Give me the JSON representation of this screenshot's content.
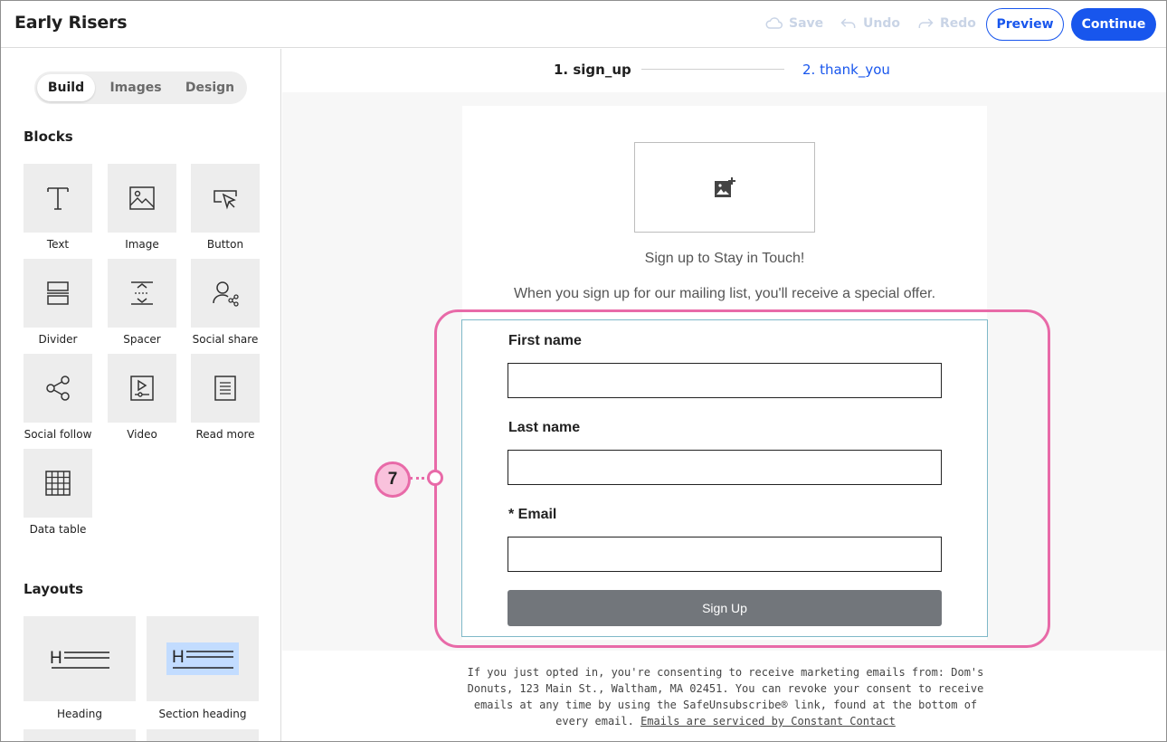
{
  "header": {
    "title": "Early Risers",
    "save_label": "Save",
    "undo_label": "Undo",
    "redo_label": "Redo",
    "preview_label": "Preview",
    "continue_label": "Continue"
  },
  "sidebar": {
    "tabs": [
      {
        "label": "Build",
        "active": true
      },
      {
        "label": "Images",
        "active": false
      },
      {
        "label": "Design",
        "active": false
      }
    ],
    "blocks_title": "Blocks",
    "blocks": [
      {
        "label": "Text",
        "icon": "text-icon"
      },
      {
        "label": "Image",
        "icon": "image-icon"
      },
      {
        "label": "Button",
        "icon": "button-icon"
      },
      {
        "label": "Divider",
        "icon": "divider-icon"
      },
      {
        "label": "Spacer",
        "icon": "spacer-icon"
      },
      {
        "label": "Social share",
        "icon": "social-share-icon"
      },
      {
        "label": "Social follow",
        "icon": "social-follow-icon"
      },
      {
        "label": "Video",
        "icon": "video-icon"
      },
      {
        "label": "Read more",
        "icon": "read-more-icon"
      },
      {
        "label": "Data table",
        "icon": "data-table-icon"
      }
    ],
    "layouts_title": "Layouts",
    "layouts": [
      {
        "label": "Heading",
        "icon": "heading-icon"
      },
      {
        "label": "Section heading",
        "icon": "section-heading-icon"
      }
    ]
  },
  "steps": [
    {
      "label": "1.  sign_up",
      "active": true
    },
    {
      "label": "2.  thank_you",
      "active": false
    }
  ],
  "form": {
    "heading": "Sign up to Stay in Touch!",
    "text": "When you sign up for our mailing list, you'll receive a special offer.",
    "fields": [
      {
        "label": "First name",
        "value": ""
      },
      {
        "label": "Last name",
        "value": ""
      },
      {
        "label": "* Email",
        "value": ""
      }
    ],
    "submit_label": "Sign Up"
  },
  "footer": {
    "text": "If you just opted in, you're consenting to receive marketing emails from: Dom's Donuts, 123 Main St., Waltham, MA 02451. You can revoke your consent to receive emails at any time by using the SafeUnsubscribe® link, found at the bottom of every email.",
    "link": "Emails are serviced by Constant Contact"
  },
  "annotation": {
    "number": "7",
    "color": "#e86aa8",
    "fill": "#f9c2dc"
  },
  "colors": {
    "accent": "#1856ed",
    "button_gray": "#72767b"
  }
}
